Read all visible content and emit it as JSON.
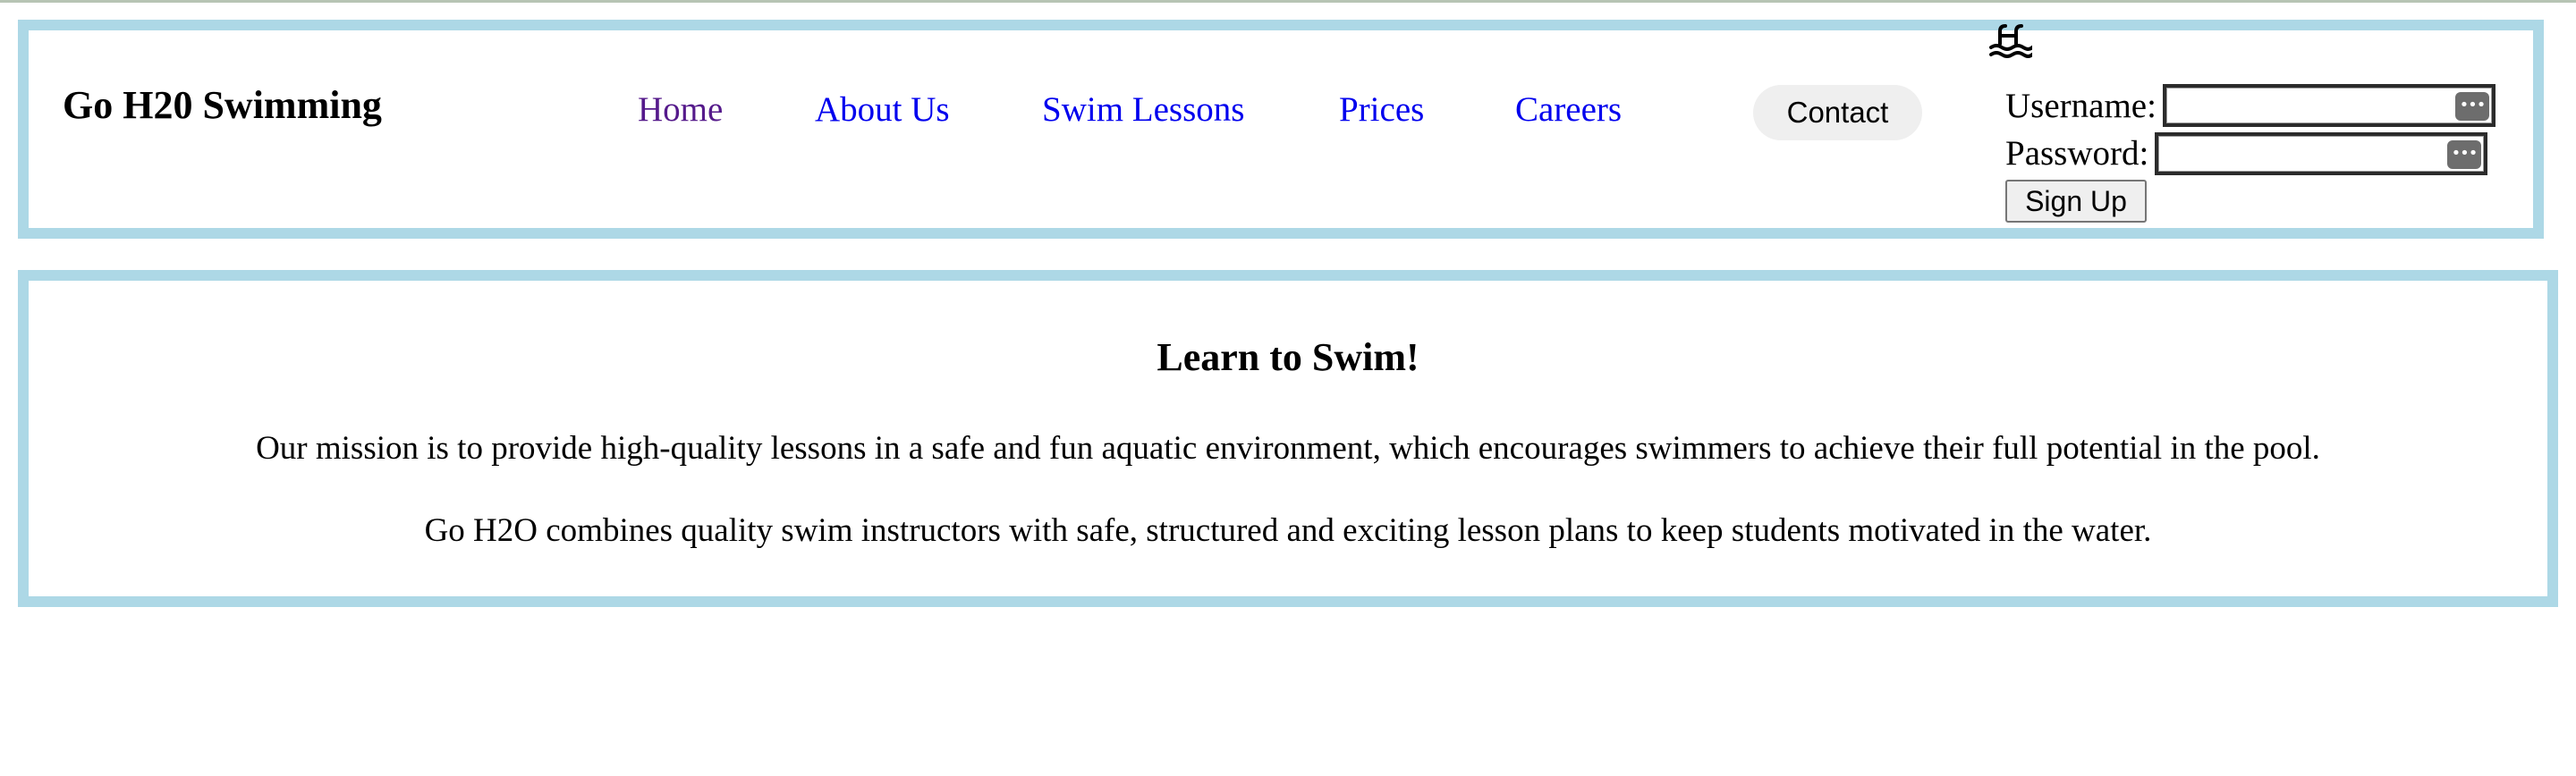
{
  "header": {
    "brand": "Go H20 Swimming",
    "nav": [
      {
        "label": "Home",
        "visited": true
      },
      {
        "label": "About Us"
      },
      {
        "label": "Swim Lessons"
      },
      {
        "label": "Prices"
      },
      {
        "label": "Careers"
      }
    ],
    "contact_label": "Contact",
    "icon": "swimming-pool-icon"
  },
  "login": {
    "username_label": "Username:",
    "password_label": "Password:",
    "username_value": "",
    "password_value": "",
    "signup_label": "Sign Up"
  },
  "main": {
    "title": "Learn to Swim!",
    "paragraphs": [
      "Our mission is to provide high-quality lessons in a safe and fun aquatic environment, which encourages swimmers to achieve their full potential in the pool.",
      "Go H2O combines quality swim instructors with safe, structured and exciting lesson plans to keep students motivated in the water."
    ]
  },
  "colors": {
    "border": "#add8e6",
    "link": "#0000ee",
    "visited_link": "#551a8b"
  }
}
